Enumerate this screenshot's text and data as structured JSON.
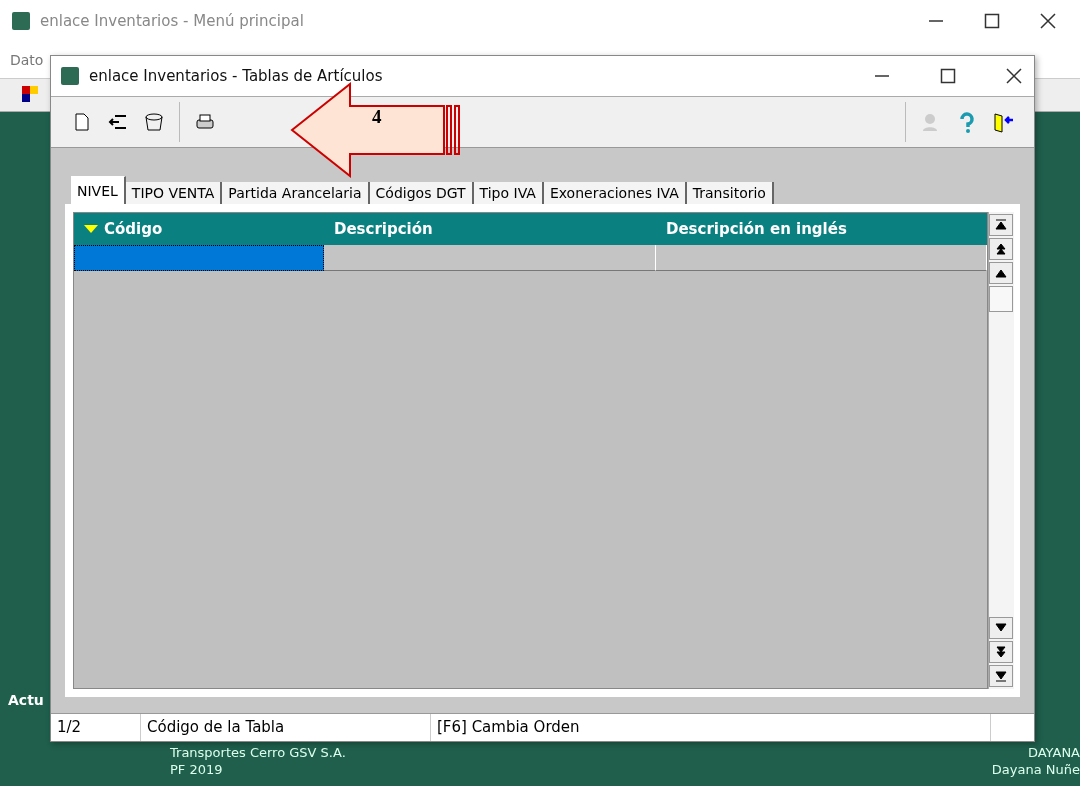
{
  "main_window": {
    "title": "enlace Inventarios - Menú principal",
    "menu": [
      "Dato"
    ],
    "side_label": "Actu",
    "company": "Transportes Cerro GSV S.A.",
    "period": "PF 2019",
    "user_code": "DAYANA",
    "user_name": "Dayana Nuñe"
  },
  "window": {
    "title": "enlace Inventarios - Tablas de Artículos",
    "tabs": [
      {
        "label": "NIVEL",
        "selected": true
      },
      {
        "label": "TIPO VENTA",
        "selected": false
      },
      {
        "label": "Partida Arancelaria",
        "selected": false
      },
      {
        "label": "Códigos DGT",
        "selected": false
      },
      {
        "label": "Tipo IVA",
        "selected": false
      },
      {
        "label": "Exoneraciones IVA",
        "selected": false
      },
      {
        "label": "Transitorio",
        "selected": false
      }
    ],
    "table": {
      "columns": [
        "Código",
        "Descripción",
        "Descripción en inglés"
      ],
      "rows": [
        {
          "selected": true
        }
      ]
    },
    "status_bar": [
      "1/2",
      "Código de la Tabla",
      "[F6] Cambia Orden"
    ]
  },
  "annotation": {
    "label": "4"
  }
}
